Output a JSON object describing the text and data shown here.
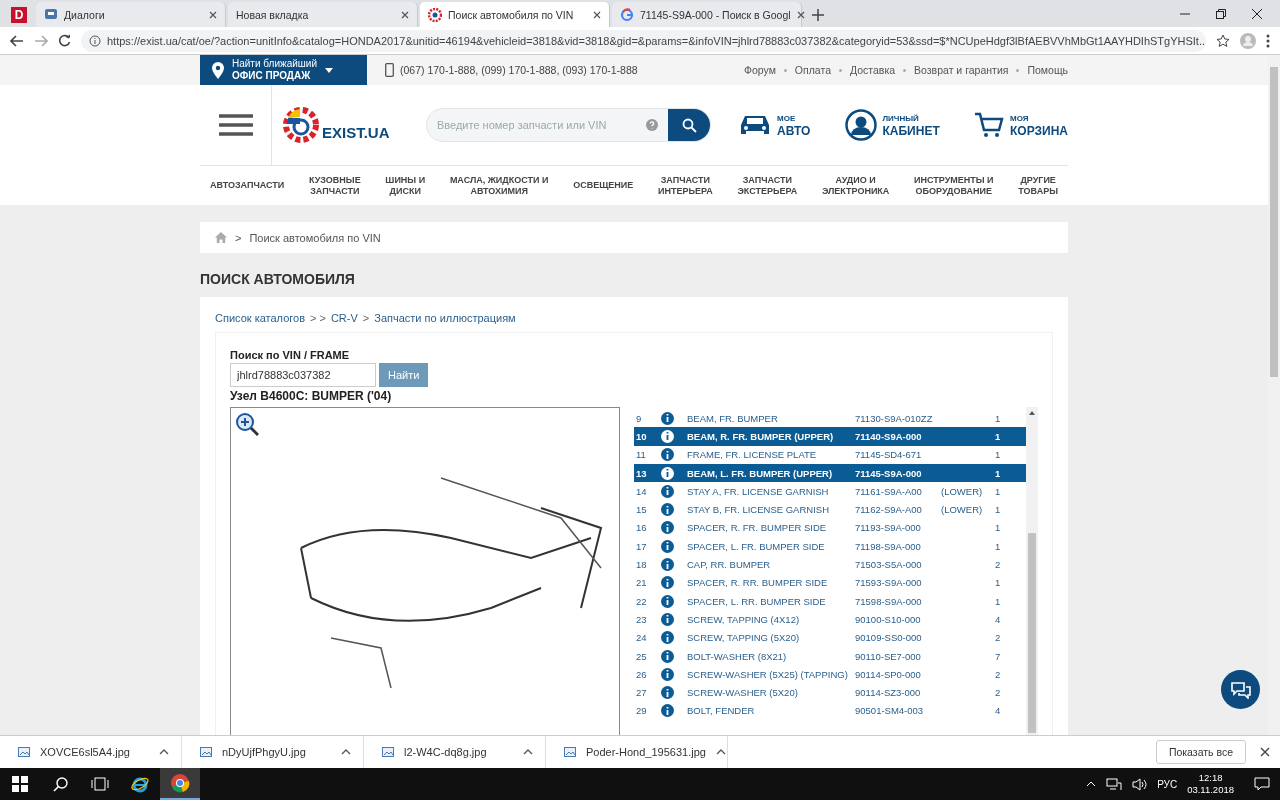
{
  "browser": {
    "pinned_tab": {
      "label": "D"
    },
    "tabs": [
      {
        "title": "Диалоги",
        "kind": "chat",
        "selected": false
      },
      {
        "title": "Новая вкладка",
        "kind": "blank",
        "selected": false
      },
      {
        "title": "Поиск автомобиля по VIN",
        "kind": "site",
        "selected": true
      },
      {
        "title": "71145-S9A-000 - Поиск в Googl",
        "kind": "search",
        "selected": false
      }
    ],
    "url": "https://exist.ua/cat/oe/?action=unitInfo&catalog=HONDA2017&unitid=46194&vehicleid=3818&vid=3818&gid=&params=&infoVIN=jhlrd78883c037382&categoryid=53&ssd=$*NCUpeHdgf3lBfAEBVVhMbGt1AAYHDIhSTgYHSIt..."
  },
  "topbar": {
    "office": {
      "line1": "Найти ближайший",
      "line2": "ОФИС ПРОДАЖ"
    },
    "phones": "(067) 170-1-888, (099) 170-1-888, (093) 170-1-888",
    "links": [
      "Форум",
      "Оплата",
      "Доставка",
      "Возврат и гарантия",
      "Помощь"
    ]
  },
  "header": {
    "logo": "EXIST.UA",
    "search_placeholder": "Введите номер запчасти или VIN",
    "actions": [
      {
        "small": "МОЕ",
        "big": "АВТО"
      },
      {
        "small": "ЛИЧНЫЙ",
        "big": "КАБИНЕТ"
      },
      {
        "small": "МОЯ",
        "big": "КОРЗИНА"
      }
    ]
  },
  "nav": [
    {
      "lines": [
        "АВТОЗАПЧАСТИ"
      ]
    },
    {
      "lines": [
        "КУЗОВНЫЕ",
        "ЗАПЧАСТИ"
      ]
    },
    {
      "lines": [
        "ШИНЫ И",
        "ДИСКИ"
      ]
    },
    {
      "lines": [
        "МАСЛА, ЖИДКОСТИ И",
        "АВТОХИМИЯ"
      ]
    },
    {
      "lines": [
        "ОСВЕЩЕНИЕ"
      ]
    },
    {
      "lines": [
        "ЗАПЧАСТИ",
        "ИНТЕРЬЕРА"
      ]
    },
    {
      "lines": [
        "ЗАПЧАСТИ",
        "ЭКСТЕРЬЕРА"
      ]
    },
    {
      "lines": [
        "АУДИО И",
        "ЭЛЕКТРОНИКА"
      ]
    },
    {
      "lines": [
        "ИНСТРУМЕНТЫ И",
        "ОБОРУДОВАНИЕ"
      ]
    },
    {
      "lines": [
        "ДРУГИЕ",
        "ТОВАРЫ"
      ]
    }
  ],
  "breadcrumb": {
    "separator": ">",
    "current": "Поиск автомобиля по VIN"
  },
  "page_title": "ПОИСК АВТОМОБИЛЯ",
  "catalog_path": [
    {
      "label": "Список каталогов",
      "separator": "> >"
    },
    {
      "label": "CR-V",
      "separator": ">"
    },
    {
      "label": "Запчасти по иллюстрациям"
    }
  ],
  "vin_search": {
    "label": "Поиск по VIN / FRAME",
    "value": "jhlrd78883c037382",
    "button": "Найти"
  },
  "unit_title": "Узел B4600C: BUMPER ('04)",
  "parts": [
    {
      "num": "9",
      "name": "BEAM, FR. BUMPER",
      "part": "71130-S9A-010ZZ",
      "qty": "1",
      "selected": false
    },
    {
      "num": "10",
      "name": "BEAM, R. FR. BUMPER (UPPER)",
      "part": "71140-S9A-000",
      "qty": "1",
      "selected": true
    },
    {
      "num": "11",
      "name": "FRAME, FR. LICENSE PLATE",
      "part": "71145-SD4-671",
      "qty": "1",
      "selected": false
    },
    {
      "num": "13",
      "name": "BEAM, L. FR. BUMPER (UPPER)",
      "part": "71145-S9A-000",
      "qty": "1",
      "selected": true
    },
    {
      "num": "14",
      "name": "STAY A, FR. LICENSE GARNISH",
      "part": "71161-S9A-A00",
      "note": "(LOWER)",
      "qty": "1",
      "selected": false
    },
    {
      "num": "15",
      "name": "STAY B, FR. LICENSE GARNISH",
      "part": "71162-S9A-A00",
      "note": "(LOWER)",
      "qty": "1",
      "selected": false
    },
    {
      "num": "16",
      "name": "SPACER, R. FR. BUMPER SIDE",
      "part": "71193-S9A-000",
      "qty": "1",
      "selected": false
    },
    {
      "num": "17",
      "name": "SPACER, L. FR. BUMPER SIDE",
      "part": "71198-S9A-000",
      "qty": "1",
      "selected": false
    },
    {
      "num": "18",
      "name": "CAP, RR. BUMPER",
      "part": "71503-S5A-000",
      "qty": "2",
      "selected": false
    },
    {
      "num": "21",
      "name": "SPACER, R. RR. BUMPER SIDE",
      "part": "71593-S9A-000",
      "qty": "1",
      "selected": false
    },
    {
      "num": "22",
      "name": "SPACER, L. RR. BUMPER SIDE",
      "part": "71598-S9A-000",
      "qty": "1",
      "selected": false
    },
    {
      "num": "23",
      "name": "SCREW, TAPPING (4X12)",
      "part": "90100-S10-000",
      "qty": "4",
      "selected": false
    },
    {
      "num": "24",
      "name": "SCREW, TAPPING (5X20)",
      "part": "90109-SS0-000",
      "qty": "2",
      "selected": false
    },
    {
      "num": "25",
      "name": "BOLT-WASHER (8X21)",
      "part": "90110-SE7-000",
      "qty": "7",
      "selected": false
    },
    {
      "num": "26",
      "name": "SCREW-WASHER (5X25) (TAPPING)",
      "part": "90114-SP0-000",
      "qty": "2",
      "selected": false
    },
    {
      "num": "27",
      "name": "SCREW-WASHER (5X20)",
      "part": "90114-SZ3-000",
      "qty": "2",
      "selected": false
    },
    {
      "num": "29",
      "name": "BOLT, FENDER",
      "part": "90501-SM4-003",
      "qty": "4",
      "selected": false
    }
  ],
  "downloads": {
    "files": [
      "XOVCE6sl5A4.jpg",
      "nDyUjfPhgyU.jpg",
      "l2-W4C-dq8g.jpg",
      "Poder-Hond_195631.jpg"
    ],
    "show_all": "Показать все"
  },
  "taskbar": {
    "apps": [
      {
        "selected": false
      },
      {
        "selected": true
      }
    ],
    "language": "РУС",
    "time": "12:18",
    "date": "03.11.2018"
  }
}
